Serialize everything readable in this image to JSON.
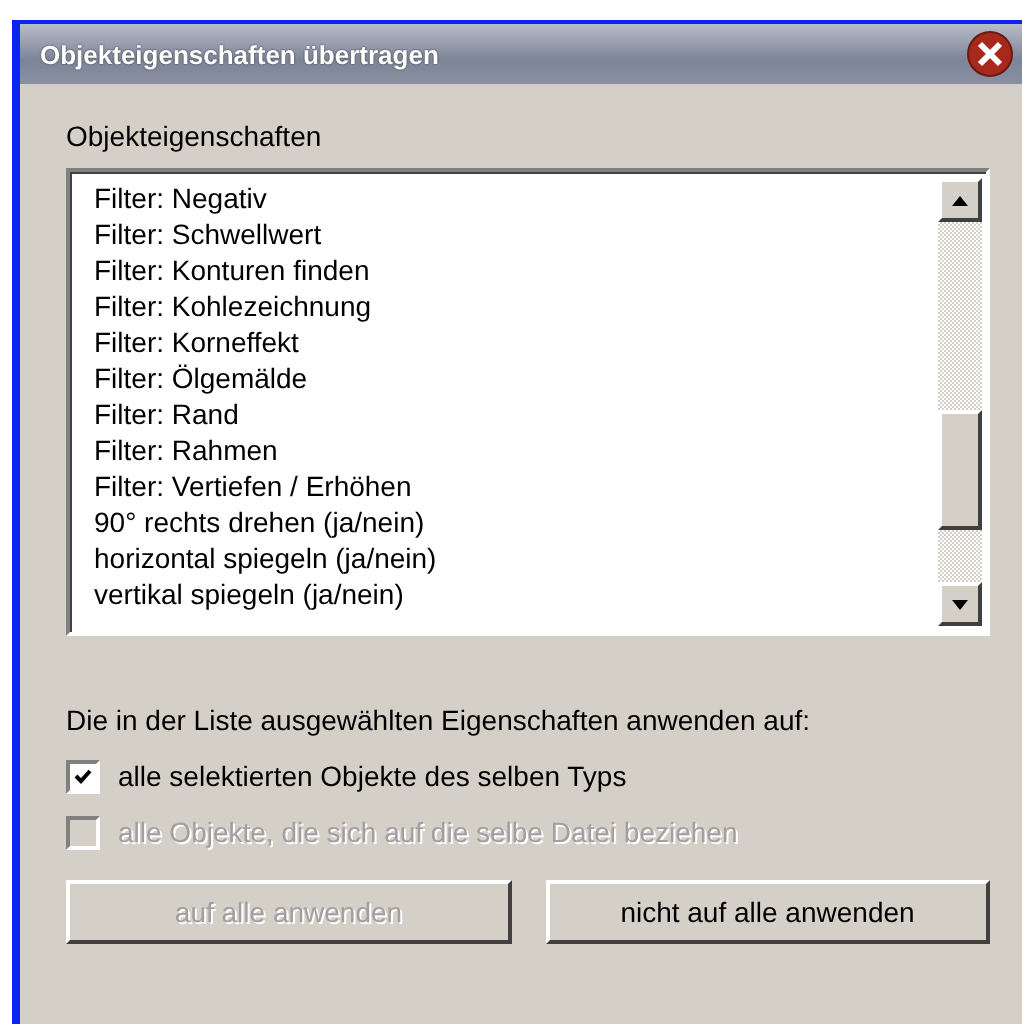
{
  "window": {
    "title": "Objekteigenschaften übertragen"
  },
  "list": {
    "label": "Objekteigenschaften",
    "items": [
      {
        "label": "Filter: Negativ"
      },
      {
        "label": "Filter: Schwellwert"
      },
      {
        "label": "Filter: Konturen finden"
      },
      {
        "label": "Filter: Kohlezeichnung"
      },
      {
        "label": "Filter: Korneffekt"
      },
      {
        "label": "Filter: Ölgemälde"
      },
      {
        "label": "Filter: Rand"
      },
      {
        "label": "Filter: Rahmen"
      },
      {
        "label": "Filter: Vertiefen / Erhöhen"
      },
      {
        "label": "90° rechts drehen (ja/nein)"
      },
      {
        "label": "horizontal spiegeln (ja/nein)"
      },
      {
        "label": "vertikal spiegeln (ja/nein)"
      }
    ]
  },
  "apply_label": "Die in der Liste ausgewählten Eigenschaften anwenden auf:",
  "options": [
    {
      "label": "alle selektierten Objekte des selben Typs",
      "checked": true,
      "disabled": false
    },
    {
      "label": "alle Objekte, die sich auf die selbe Datei beziehen",
      "checked": false,
      "disabled": true
    }
  ],
  "buttons": [
    {
      "label": "auf alle anwenden",
      "disabled": true
    },
    {
      "label": "nicht auf alle anwenden",
      "disabled": false
    }
  ]
}
